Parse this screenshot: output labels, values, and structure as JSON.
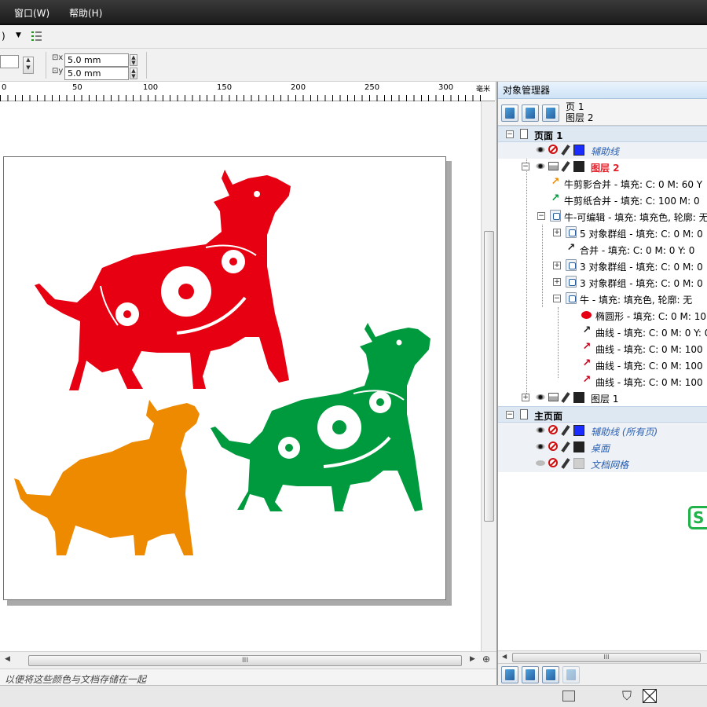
{
  "menu": {
    "window": "窗口(W)",
    "help": "帮助(H)"
  },
  "toolbar": {
    "zoom_suffix": ")",
    "nudge_x": "5.0 mm",
    "nudge_y": "5.0 mm"
  },
  "ruler": {
    "labels": [
      "0",
      "50",
      "100",
      "150",
      "200",
      "250",
      "300"
    ],
    "unit": "毫米"
  },
  "statusline": {
    "text": "以便将这些颜色与文档存储在一起"
  },
  "docker": {
    "title": "对象管理器",
    "page_info": "页 1",
    "layer_info": "图层 2",
    "tree": [
      {
        "label": "页面 1"
      },
      {
        "label": "辅助线"
      },
      {
        "label": "图层 2"
      },
      {
        "label": "牛剪影合并 - 填充: C: 0 M: 60 Y"
      },
      {
        "label": "牛剪纸合并 - 填充: C: 100 M: 0"
      },
      {
        "label": "牛-可编辑 - 填充: 填充色, 轮廓: 无"
      },
      {
        "label": "5 对象群组 - 填充: C: 0 M: 0"
      },
      {
        "label": "合并 - 填充: C: 0 M: 0 Y: 0"
      },
      {
        "label": "3 对象群组 - 填充: C: 0 M: 0"
      },
      {
        "label": "3 对象群组 - 填充: C: 0 M: 0"
      },
      {
        "label": "牛 - 填充: 填充色, 轮廓: 无"
      },
      {
        "label": "椭圆形 - 填充: C: 0 M: 10"
      },
      {
        "label": "曲线 - 填充: C: 0 M: 0 Y: 0"
      },
      {
        "label": "曲线 - 填充: C: 0 M: 100"
      },
      {
        "label": "曲线 - 填充: C: 0 M: 100"
      },
      {
        "label": "曲线 - 填充: C: 0 M: 100"
      },
      {
        "label": "图层 1"
      },
      {
        "label": "主页面"
      },
      {
        "label": "辅助线 (所有页)"
      },
      {
        "label": "桌面"
      },
      {
        "label": "文档网格"
      }
    ]
  },
  "colors": {
    "red_ox": "#e60012",
    "green_ox": "#009a3e",
    "orange_ox": "#ee8a00",
    "guide_blue": "#1a2cff",
    "layer_red": "#e8202a",
    "link_blue": "#2a5fb0"
  },
  "scrollbar": {
    "grip": "III"
  }
}
